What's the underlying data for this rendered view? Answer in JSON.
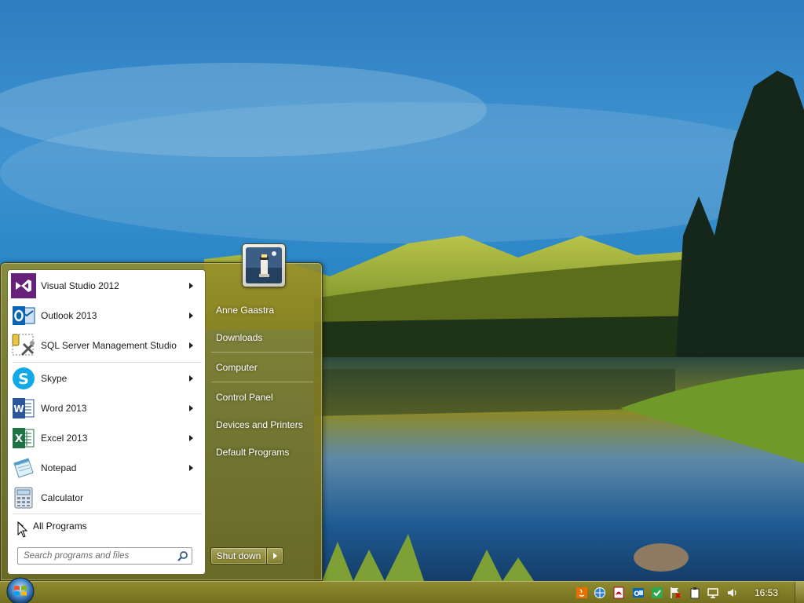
{
  "start_menu": {
    "pinned": [
      {
        "label": "Visual Studio 2012",
        "icon": "visual-studio-icon",
        "arrow": true
      },
      {
        "label": "Outlook 2013",
        "icon": "outlook-icon",
        "arrow": true
      },
      {
        "label": "SQL Server Management Studio",
        "icon": "sql-server-icon",
        "arrow": true
      }
    ],
    "recent": [
      {
        "label": "Skype",
        "icon": "skype-icon",
        "arrow": true
      },
      {
        "label": "Word 2013",
        "icon": "word-icon",
        "arrow": true
      },
      {
        "label": "Excel 2013",
        "icon": "excel-icon",
        "arrow": true
      },
      {
        "label": "Notepad",
        "icon": "notepad-icon",
        "arrow": true
      },
      {
        "label": "Calculator",
        "icon": "calculator-icon",
        "arrow": false
      }
    ],
    "all_programs_label": "All Programs",
    "search_placeholder": "Search programs and files",
    "right_pane": {
      "user_name": "Anne Gaastra",
      "items": [
        "Downloads",
        "Computer",
        "Control Panel",
        "Devices and Printers",
        "Default Programs"
      ]
    },
    "shutdown_label": "Shut down"
  },
  "taskbar": {
    "clock": "16:53",
    "tray_icons": [
      "java-icon",
      "network-globe-icon",
      "pdf-icon",
      "outlook-tray-icon",
      "checkmark-icon",
      "flag-icon",
      "clipboard-icon",
      "display-icon",
      "speaker-icon"
    ]
  },
  "colors": {
    "accent": "#8c8226",
    "text_on_glass": "#ffffff",
    "menu_text": "#1b1b1b"
  }
}
